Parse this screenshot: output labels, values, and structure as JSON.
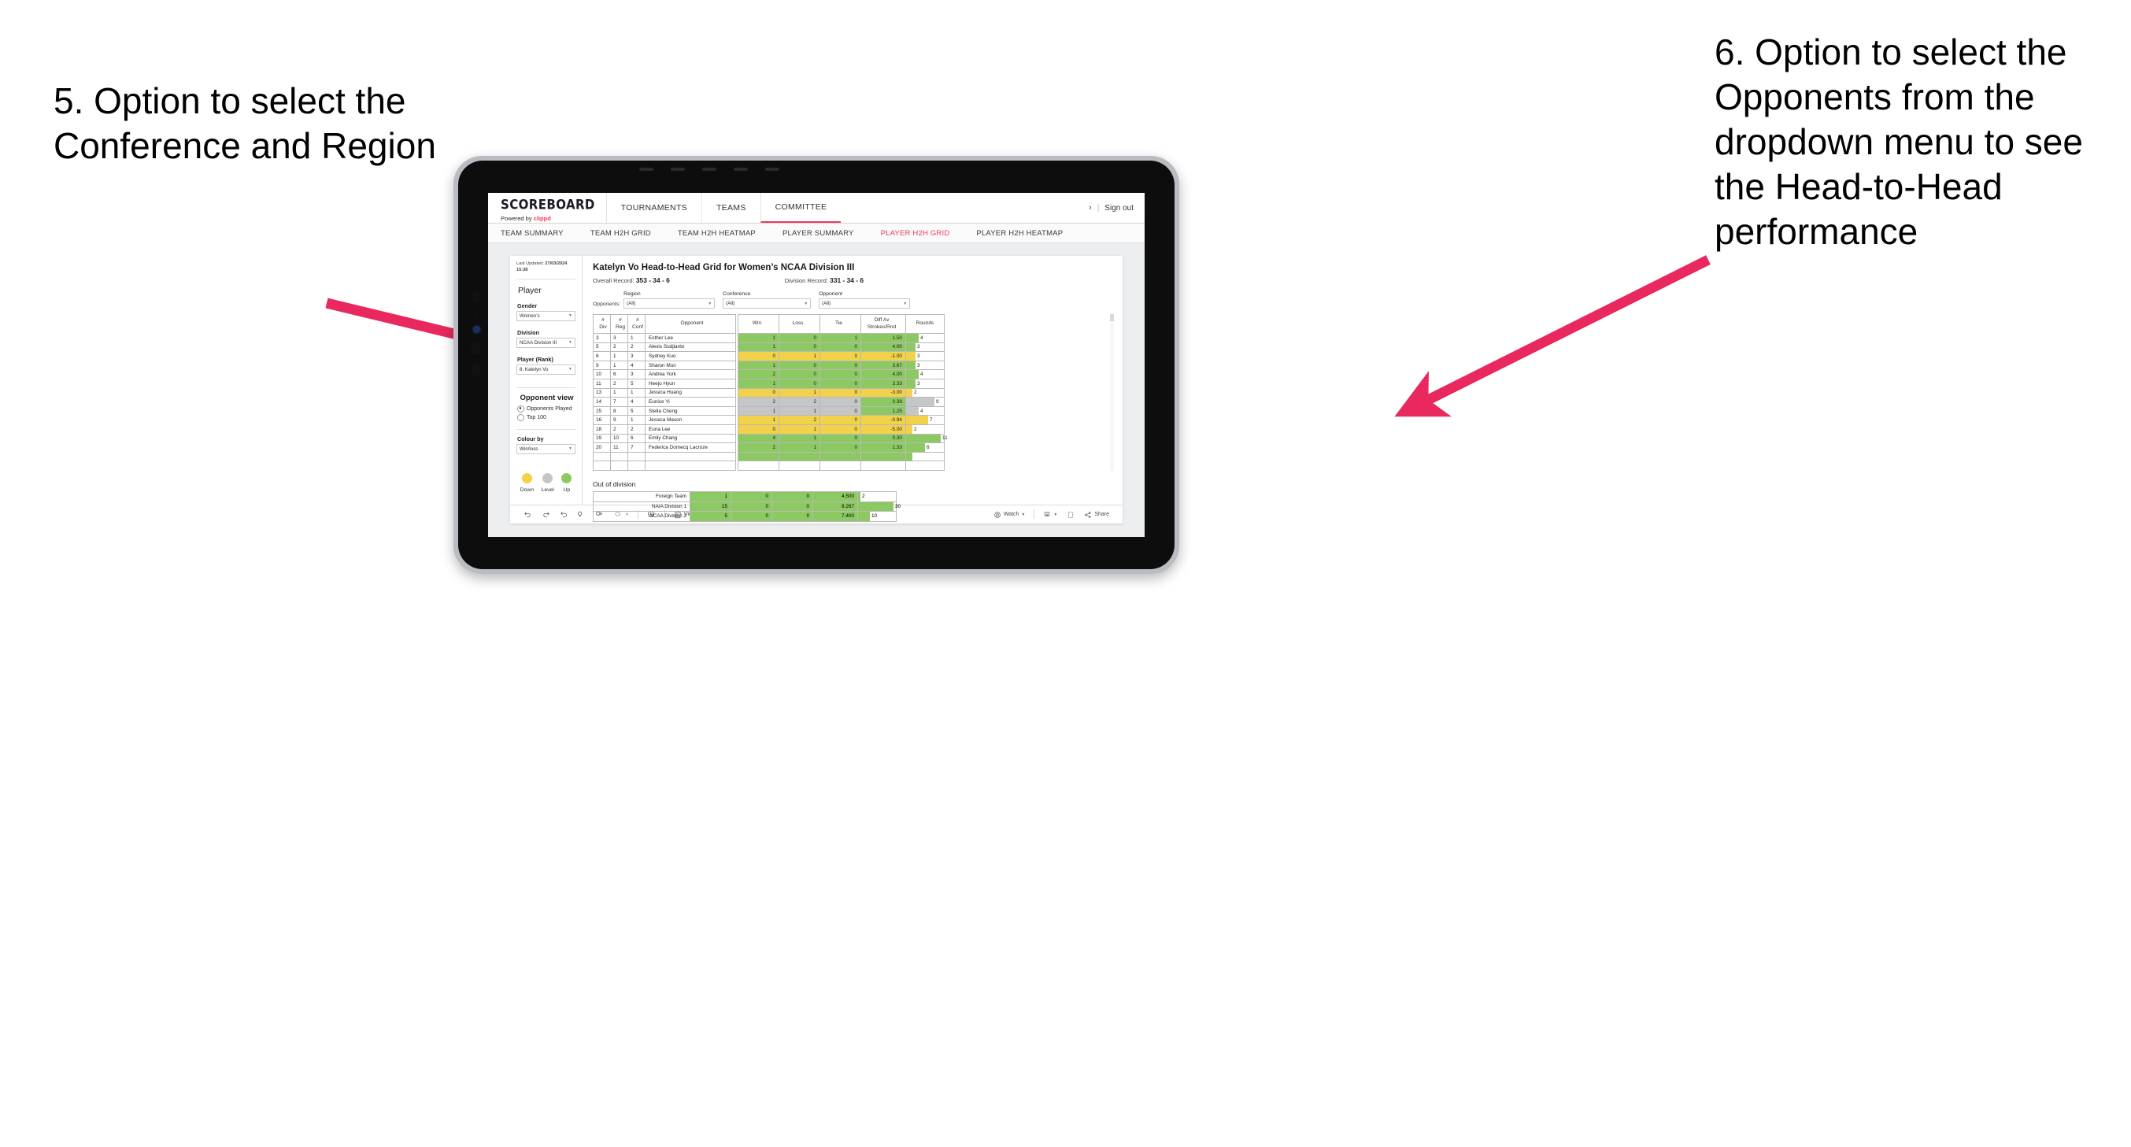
{
  "annotations": {
    "left": "5. Option to select the Conference and Region",
    "right": "6. Option to select the Opponents from the dropdown menu to see the Head-to-Head performance"
  },
  "nav": {
    "logo_main": "SCOREBOARD",
    "logo_sub_prefix": "Powered by ",
    "logo_sub_brand": "clippd",
    "items": [
      {
        "label": "TOURNAMENTS",
        "active": false
      },
      {
        "label": "TEAMS",
        "active": false
      },
      {
        "label": "COMMITTEE",
        "active": true
      }
    ],
    "chevron": "›",
    "separator": "|",
    "sign_out": "Sign out"
  },
  "subnav": {
    "items": [
      {
        "label": "TEAM SUMMARY",
        "active": false
      },
      {
        "label": "TEAM H2H GRID",
        "active": false
      },
      {
        "label": "TEAM H2H HEATMAP",
        "active": false
      },
      {
        "label": "PLAYER SUMMARY",
        "active": false
      },
      {
        "label": "PLAYER H2H GRID",
        "active": true
      },
      {
        "label": "PLAYER H2H HEATMAP",
        "active": false
      }
    ]
  },
  "sidebar": {
    "last_updated_label": "Last Updated:",
    "last_updated_date": "27/03/2024",
    "last_updated_time": "15:38",
    "player_heading": "Player",
    "gender_label": "Gender",
    "gender_value": "Women’s",
    "division_label": "Division",
    "division_value": "NCAA Division III",
    "player_rank_label": "Player (Rank)",
    "player_rank_value": "8. Katelyn Vo",
    "opponent_view_heading": "Opponent view",
    "radio_opponents_played": "Opponents Played",
    "radio_top_100": "Top 100",
    "colour_by_label": "Colour by",
    "colour_by_value": "Win/loss",
    "legend": [
      {
        "label": "Down",
        "color": "#f2d24b"
      },
      {
        "label": "Level",
        "color": "#c4c6c8"
      },
      {
        "label": "Up",
        "color": "#8dc963"
      }
    ]
  },
  "main": {
    "title": "Katelyn Vo Head-to-Head Grid for Women’s NCAA Division III",
    "overall_record_label": "Overall Record:",
    "overall_record_value": "353 - 34 - 6",
    "division_record_label": "Division Record:",
    "division_record_value": "331 - 34 - 6",
    "opponents_label": "Opponents:",
    "filters": [
      {
        "title": "Region",
        "value": "(All)"
      },
      {
        "title": "Conference",
        "value": "(All)"
      },
      {
        "title": "Opponent",
        "value": "(All)"
      }
    ],
    "out_of_division_title": "Out of division"
  },
  "chart_data": {
    "type": "table",
    "title": "Katelyn Vo Head-to-Head Grid for Women’s NCAA Division III",
    "columns": [
      "# Div",
      "# Reg",
      "# Conf",
      "Opponent",
      "Win",
      "Loss",
      "Tie",
      "Diff Av Strokes/Rnd",
      "Rounds"
    ],
    "column_headers_multiline": [
      [
        "#",
        "Div"
      ],
      [
        "#",
        "Reg"
      ],
      [
        "#",
        "Conf"
      ],
      [
        "Opponent"
      ],
      [
        "Win"
      ],
      [
        "Loss"
      ],
      [
        "Tie"
      ],
      [
        "Diff Av",
        "Strokes/Rnd"
      ],
      [
        "Rounds"
      ]
    ],
    "colour_legend": {
      "down": "#f2d24b",
      "level": "#c4c6c8",
      "up": "#8dc963"
    },
    "rounds_max": 12,
    "rows": [
      {
        "div": "3",
        "reg": "3",
        "conf": "1",
        "opponent": "Esther Lee",
        "win": "1",
        "loss": "0",
        "tie": "1",
        "diff": "1.50",
        "rounds": "4",
        "state": "up"
      },
      {
        "div": "5",
        "reg": "2",
        "conf": "2",
        "opponent": "Alexis Sudjianto",
        "win": "1",
        "loss": "0",
        "tie": "0",
        "diff": "4.00",
        "rounds": "3",
        "state": "up"
      },
      {
        "div": "6",
        "reg": "1",
        "conf": "3",
        "opponent": "Sydney Kuo",
        "win": "0",
        "loss": "1",
        "tie": "0",
        "diff": "-1.00",
        "rounds": "3",
        "state": "down"
      },
      {
        "div": "9",
        "reg": "1",
        "conf": "4",
        "opponent": "Sharon Mun",
        "win": "1",
        "loss": "0",
        "tie": "0",
        "diff": "3.67",
        "rounds": "3",
        "state": "up"
      },
      {
        "div": "10",
        "reg": "6",
        "conf": "3",
        "opponent": "Andrea York",
        "win": "2",
        "loss": "0",
        "tie": "0",
        "diff": "4.00",
        "rounds": "4",
        "state": "up"
      },
      {
        "div": "11",
        "reg": "2",
        "conf": "5",
        "opponent": "Heejo Hyun",
        "win": "1",
        "loss": "0",
        "tie": "0",
        "diff": "3.33",
        "rounds": "3",
        "state": "up"
      },
      {
        "div": "13",
        "reg": "1",
        "conf": "1",
        "opponent": "Jessica Huang",
        "win": "0",
        "loss": "1",
        "tie": "0",
        "diff": "-3.00",
        "rounds": "2",
        "state": "down"
      },
      {
        "div": "14",
        "reg": "7",
        "conf": "4",
        "opponent": "Eunice Yi",
        "win": "2",
        "loss": "2",
        "tie": "0",
        "diff": "0.38",
        "rounds": "9",
        "state": "level",
        "diff_state": "up"
      },
      {
        "div": "15",
        "reg": "8",
        "conf": "5",
        "opponent": "Stella Cheng",
        "win": "1",
        "loss": "1",
        "tie": "0",
        "diff": "1.25",
        "rounds": "4",
        "state": "level",
        "diff_state": "up"
      },
      {
        "div": "16",
        "reg": "9",
        "conf": "1",
        "opponent": "Jessica Mason",
        "win": "1",
        "loss": "2",
        "tie": "0",
        "diff": "-0.94",
        "rounds": "7",
        "state": "down"
      },
      {
        "div": "18",
        "reg": "2",
        "conf": "2",
        "opponent": "Euna Lee",
        "win": "0",
        "loss": "1",
        "tie": "0",
        "diff": "-5.00",
        "rounds": "2",
        "state": "down"
      },
      {
        "div": "19",
        "reg": "10",
        "conf": "6",
        "opponent": "Emily Chang",
        "win": "4",
        "loss": "1",
        "tie": "0",
        "diff": "0.30",
        "rounds": "11",
        "state": "up"
      },
      {
        "div": "20",
        "reg": "11",
        "conf": "7",
        "opponent": "Federica Domecq Lacroze",
        "win": "2",
        "loss": "1",
        "tie": "0",
        "diff": "1.33",
        "rounds": "6",
        "state": "up"
      }
    ],
    "out_of_division": {
      "rounds_max": 32,
      "rows": [
        {
          "label": "Foreign Team",
          "win": "1",
          "loss": "0",
          "tie": "0",
          "diff": "4.500",
          "rounds": "2",
          "state": "up"
        },
        {
          "label": "NAIA Division 1",
          "win": "15",
          "loss": "0",
          "tie": "0",
          "diff": "9.267",
          "rounds": "30",
          "state": "up"
        },
        {
          "label": "NCAA Division 2",
          "win": "5",
          "loss": "0",
          "tie": "0",
          "diff": "7.400",
          "rounds": "10",
          "state": "up"
        }
      ]
    }
  },
  "toolbar": {
    "view_label": "View: Original",
    "save_label": "Save Custom View",
    "watch_label": "Watch",
    "share_label": "Share"
  }
}
